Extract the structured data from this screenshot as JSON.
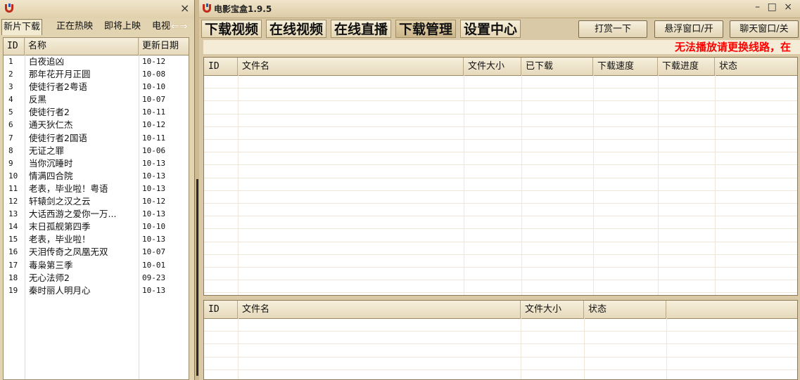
{
  "left_panel": {
    "close_glyph": "×",
    "tabs": [
      {
        "label": "新片下载",
        "active": true
      },
      {
        "label": "正在热映",
        "active": false
      },
      {
        "label": "即将上映",
        "active": false
      },
      {
        "label": "电视",
        "active": false
      }
    ],
    "tab_arrows_glyph": "⇐⇒",
    "table": {
      "headers": {
        "id": "ID",
        "name": "名称",
        "date": "更新日期"
      },
      "rows": [
        {
          "id": "1",
          "name": "白夜追凶",
          "date": "10-12"
        },
        {
          "id": "2",
          "name": "那年花开月正圆",
          "date": "10-08"
        },
        {
          "id": "3",
          "name": "使徒行者2粤语",
          "date": "10-10"
        },
        {
          "id": "4",
          "name": "反黑",
          "date": "10-07"
        },
        {
          "id": "5",
          "name": "使徒行者2",
          "date": "10-11"
        },
        {
          "id": "6",
          "name": "通天狄仁杰",
          "date": "10-12"
        },
        {
          "id": "7",
          "name": "使徒行者2国语",
          "date": "10-11"
        },
        {
          "id": "8",
          "name": "无证之罪",
          "date": "10-06"
        },
        {
          "id": "9",
          "name": "当你沉睡时",
          "date": "10-13"
        },
        {
          "id": "10",
          "name": "情满四合院",
          "date": "10-13"
        },
        {
          "id": "11",
          "name": "老表，毕业啦！粤语",
          "date": "10-13"
        },
        {
          "id": "12",
          "name": "轩辕剑之汉之云",
          "date": "10-12"
        },
        {
          "id": "13",
          "name": "大话西游之爱你一万...",
          "date": "10-13"
        },
        {
          "id": "14",
          "name": "末日孤舰第四季",
          "date": "10-10"
        },
        {
          "id": "15",
          "name": "老表，毕业啦！",
          "date": "10-13"
        },
        {
          "id": "16",
          "name": "天泪传奇之凤凰无双",
          "date": "10-07"
        },
        {
          "id": "17",
          "name": "毒枭第三季",
          "date": "10-01"
        },
        {
          "id": "18",
          "name": "无心法师2",
          "date": "09-23"
        },
        {
          "id": "19",
          "name": "秦时丽人明月心",
          "date": "10-13"
        }
      ]
    }
  },
  "window": {
    "title": "电影宝盒1.9.5",
    "controls": "– □ ×",
    "nav_tabs": [
      {
        "label": "下载视频",
        "active": false
      },
      {
        "label": "在线视频",
        "active": false
      },
      {
        "label": "在线直播",
        "active": false
      },
      {
        "label": "下载管理",
        "active": true
      },
      {
        "label": "设置中心",
        "active": false
      }
    ],
    "buttons": {
      "tip": "打赏一下",
      "float_window": "悬浮窗口/开",
      "chat_window": "聊天窗口/关"
    },
    "notice": "无法播放请更换线路，在",
    "download_table": {
      "headers": [
        "ID",
        "文件名",
        "文件大小",
        "已下载",
        "下载速度",
        "下载进度",
        "状态"
      ]
    },
    "file_table": {
      "headers": [
        "ID",
        "文件名",
        "文件大小",
        "状态",
        ""
      ]
    }
  },
  "colors": {
    "chrome": "#d9c9a6",
    "header": "#e6d9bb",
    "notice_red": "#ff0000",
    "icon_red": "#c22a1a",
    "icon_blue": "#2a57b8"
  }
}
